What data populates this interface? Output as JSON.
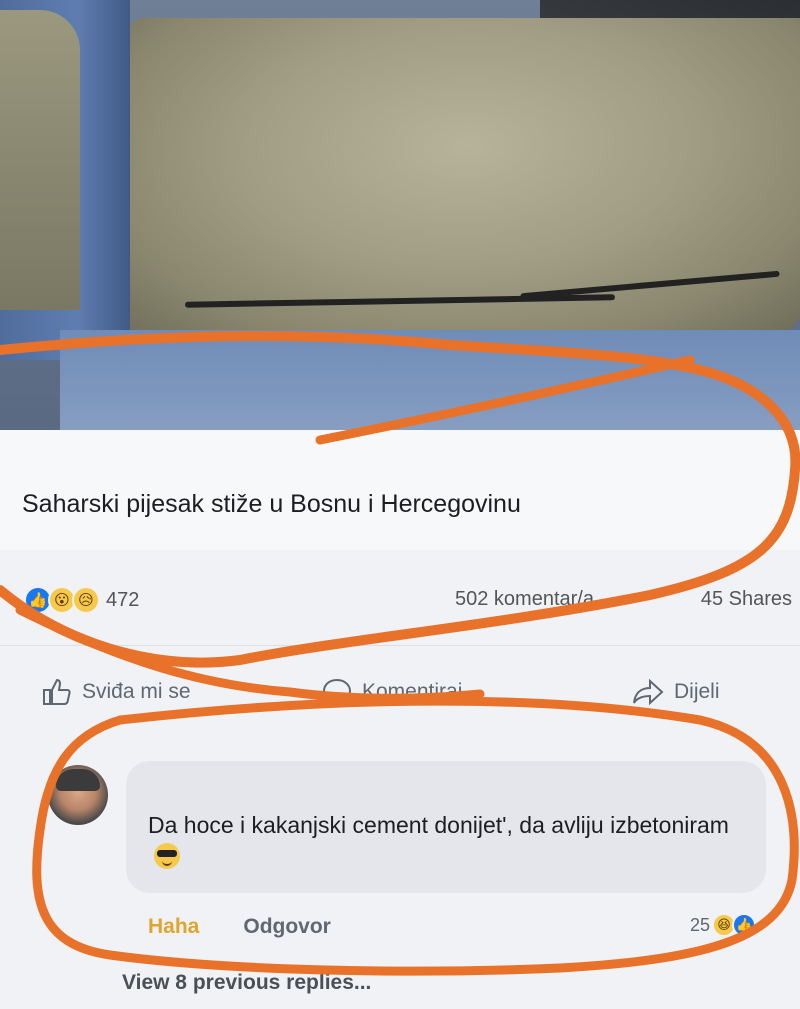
{
  "post": {
    "author_name": "",
    "caption": "Saharski pijesak stiže u Bosnu i Hercegovinu",
    "reaction_icons": [
      "like-icon",
      "wow-icon",
      "sad-icon"
    ],
    "reaction_count": "472",
    "comments_count": "502 komentar/a",
    "shares": "45 Shares"
  },
  "actions": {
    "like": "Sviđa mi se",
    "comment": "Komentiraj",
    "share": "Dijeli"
  },
  "comment": {
    "author_name": "",
    "text": "Da hoce i kakanjski cement donijet', da avliju izbetoniram",
    "emoji": "sunglasses-emoji",
    "haha_label": "Haha",
    "reply_label": "Odgovor",
    "reaction_count": "25",
    "view_previous": "View 8 previous replies..."
  },
  "colors": {
    "marker": "#e8722a",
    "facebook_blue": "#1877f2",
    "haha": "#e0a52c"
  }
}
